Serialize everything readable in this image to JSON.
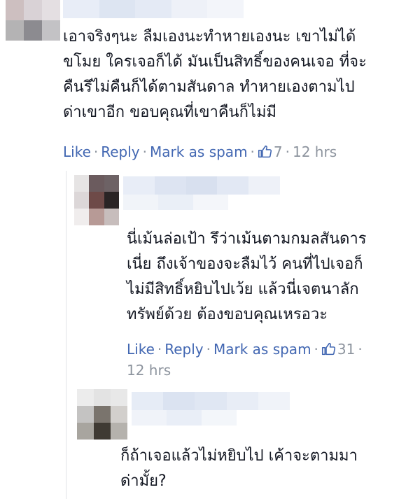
{
  "colors": {
    "link": "#4267b2",
    "text": "#141823",
    "meta": "#8d949e"
  },
  "comments": [
    {
      "text": "เอาจริงๆนะ ลืมเองนะทำหายเองนะ เขาไม่ได้\nขโมย ใครเจอก็ได้ มันเป็นสิทธิ์ของคนเจอ ที่จะ\nคืนรึไม่คืนก็ได้ตามสันดาล ทำหายเองตามไป\nด่าเขาอีก ขอบคุณที่เขาคืนก็ไม่มี",
      "actions": {
        "like": "Like",
        "reply": "Reply",
        "spam": "Mark as spam",
        "like_count": "7",
        "time": "12 hrs",
        "icon": "thumbs-up-icon"
      }
    },
    {
      "text": "นี่เม้นล่อเป้า รึว่าเม้นตามกมลสันดาร\nเนี่ย ถึงเจ้าของจะลืมไว้ คนที่ไปเจอก็\nไม่มีสิทธิ์หยิบไปเว้ย แล้วนี่เจตนาลัก\nทรัพย์ด้วย ต้องขอบคุณเหรอวะ",
      "actions": {
        "like": "Like",
        "reply": "Reply",
        "spam": "Mark as spam",
        "like_count": "31",
        "time": "12 hrs",
        "icon": "thumbs-up-icon"
      }
    },
    {
      "text": "ก็ถ้าเจอแล้วไม่หยิบไป เค้าจะตามมา\nด่ามั้ย?"
    }
  ]
}
